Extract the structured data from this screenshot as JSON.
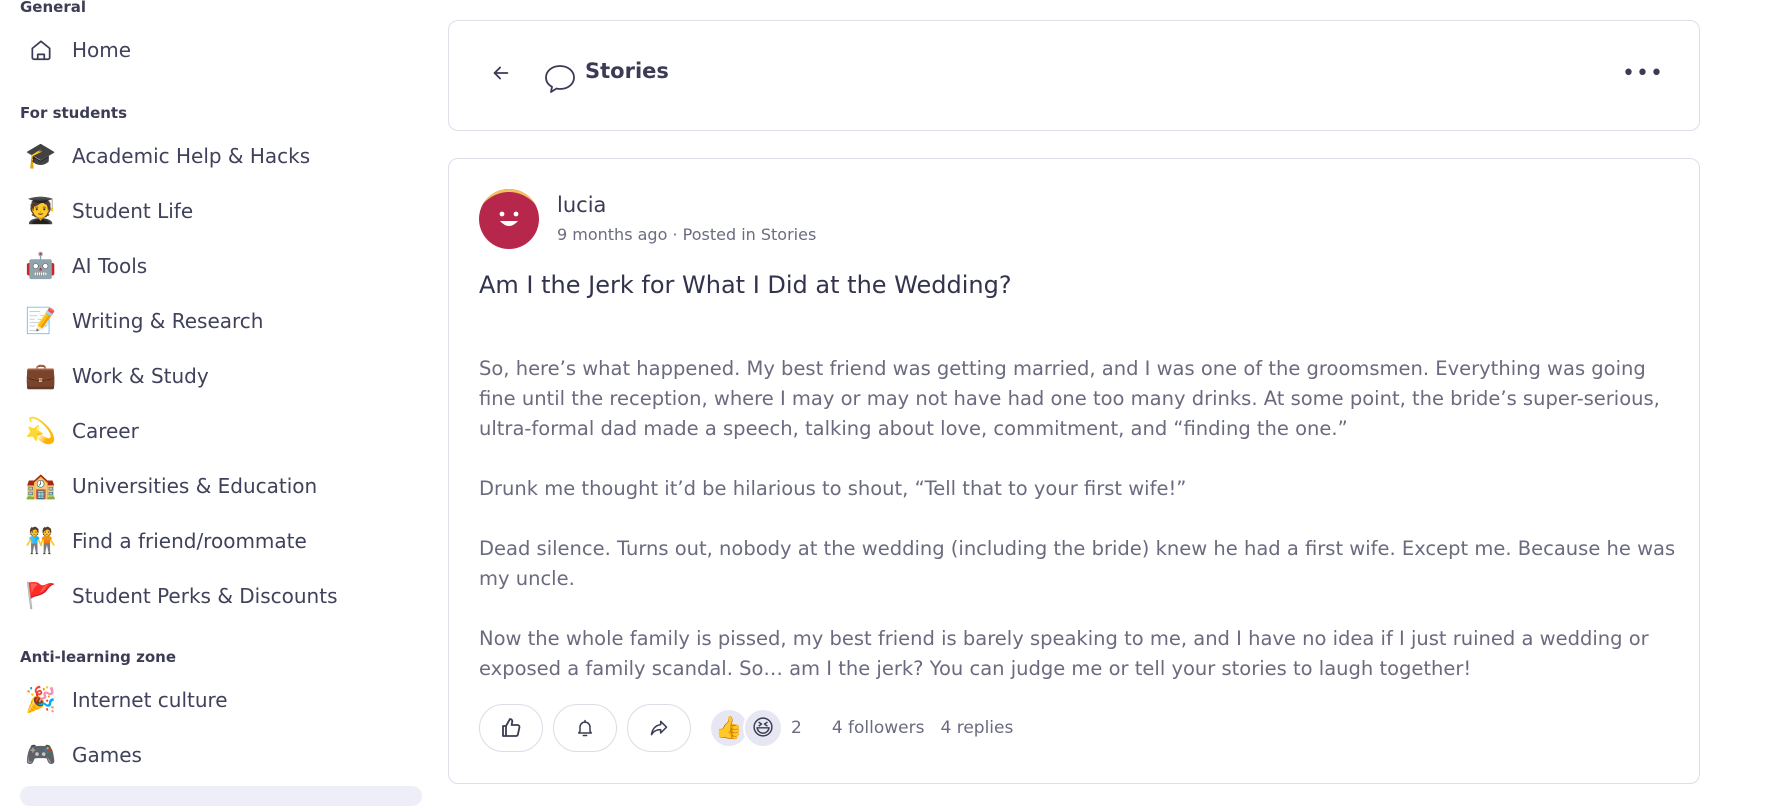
{
  "sidebar": {
    "sections": [
      {
        "title": "General"
      },
      {
        "title": "For students"
      },
      {
        "title": "Anti-learning zone"
      }
    ],
    "general_items": [
      {
        "label": "Home",
        "icon": "home-icon"
      }
    ],
    "student_items": [
      {
        "label": "Academic Help & Hacks",
        "icon": "🎓"
      },
      {
        "label": "Student Life",
        "icon": "🧑‍🎓"
      },
      {
        "label": "AI Tools",
        "icon": "🤖"
      },
      {
        "label": "Writing & Research",
        "icon": "📝"
      },
      {
        "label": "Work & Study",
        "icon": "💼"
      },
      {
        "label": "Career",
        "icon": "💫"
      },
      {
        "label": "Universities & Education",
        "icon": "🏫"
      },
      {
        "label": "Find a friend/roommate",
        "icon": "🧑‍🤝‍🧑"
      },
      {
        "label": "Student Perks & Discounts",
        "icon": "🚩"
      }
    ],
    "anti_learning_items": [
      {
        "label": "Internet culture",
        "icon": "🎉"
      },
      {
        "label": "Games",
        "icon": "🎮"
      }
    ]
  },
  "header": {
    "title": "Stories",
    "more_label": "•••"
  },
  "post": {
    "author": "lucia",
    "meta": "9 months ago · Posted in Stories",
    "title": "Am I the Jerk for What I Did at the Wedding?",
    "paragraphs": [
      "So, here’s what happened. My best friend was getting married, and I was one of the groomsmen. Everything was going fine until the reception, where I may or may not have had one too many drinks. At some point, the bride’s super-serious, ultra-formal dad made a speech, talking about love, commitment, and “finding the one.”",
      "Drunk me thought it’d be hilarious to shout, “Tell that to your first wife!”",
      "Dead silence. Turns out, nobody at the wedding (including the bride) knew he had a first wife. Except me. Because he was my uncle.",
      "Now the whole family is pissed, my best friend is barely speaking to me, and I have no idea if I just ruined a wedding or exposed a family scandal. So… am I the jerk? You can judge me or tell your stories to laugh together!"
    ],
    "reactions": {
      "emojis": [
        "👍",
        "😆"
      ],
      "count": "2"
    },
    "followers": "4 followers",
    "replies": "4 replies"
  },
  "colors": {
    "avatar_bg": "#b7264b",
    "avatar_hair": "#f1c15b",
    "border": "#dedee8",
    "text_muted": "#6a6b7f"
  }
}
